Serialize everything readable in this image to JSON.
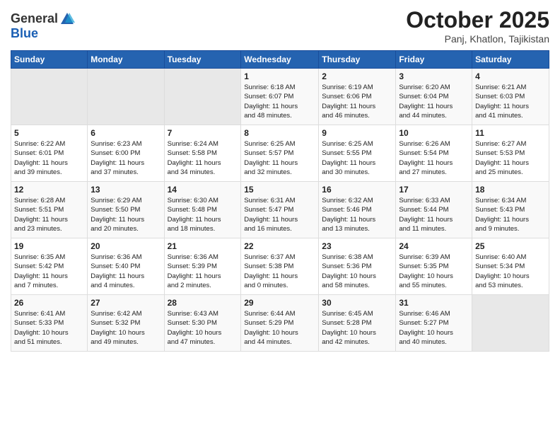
{
  "header": {
    "logo_general": "General",
    "logo_blue": "Blue",
    "month": "October 2025",
    "location": "Panj, Khatlon, Tajikistan"
  },
  "weekdays": [
    "Sunday",
    "Monday",
    "Tuesday",
    "Wednesday",
    "Thursday",
    "Friday",
    "Saturday"
  ],
  "weeks": [
    [
      {
        "day": "",
        "info": ""
      },
      {
        "day": "",
        "info": ""
      },
      {
        "day": "",
        "info": ""
      },
      {
        "day": "1",
        "info": "Sunrise: 6:18 AM\nSunset: 6:07 PM\nDaylight: 11 hours\nand 48 minutes."
      },
      {
        "day": "2",
        "info": "Sunrise: 6:19 AM\nSunset: 6:06 PM\nDaylight: 11 hours\nand 46 minutes."
      },
      {
        "day": "3",
        "info": "Sunrise: 6:20 AM\nSunset: 6:04 PM\nDaylight: 11 hours\nand 44 minutes."
      },
      {
        "day": "4",
        "info": "Sunrise: 6:21 AM\nSunset: 6:03 PM\nDaylight: 11 hours\nand 41 minutes."
      }
    ],
    [
      {
        "day": "5",
        "info": "Sunrise: 6:22 AM\nSunset: 6:01 PM\nDaylight: 11 hours\nand 39 minutes."
      },
      {
        "day": "6",
        "info": "Sunrise: 6:23 AM\nSunset: 6:00 PM\nDaylight: 11 hours\nand 37 minutes."
      },
      {
        "day": "7",
        "info": "Sunrise: 6:24 AM\nSunset: 5:58 PM\nDaylight: 11 hours\nand 34 minutes."
      },
      {
        "day": "8",
        "info": "Sunrise: 6:25 AM\nSunset: 5:57 PM\nDaylight: 11 hours\nand 32 minutes."
      },
      {
        "day": "9",
        "info": "Sunrise: 6:25 AM\nSunset: 5:55 PM\nDaylight: 11 hours\nand 30 minutes."
      },
      {
        "day": "10",
        "info": "Sunrise: 6:26 AM\nSunset: 5:54 PM\nDaylight: 11 hours\nand 27 minutes."
      },
      {
        "day": "11",
        "info": "Sunrise: 6:27 AM\nSunset: 5:53 PM\nDaylight: 11 hours\nand 25 minutes."
      }
    ],
    [
      {
        "day": "12",
        "info": "Sunrise: 6:28 AM\nSunset: 5:51 PM\nDaylight: 11 hours\nand 23 minutes."
      },
      {
        "day": "13",
        "info": "Sunrise: 6:29 AM\nSunset: 5:50 PM\nDaylight: 11 hours\nand 20 minutes."
      },
      {
        "day": "14",
        "info": "Sunrise: 6:30 AM\nSunset: 5:48 PM\nDaylight: 11 hours\nand 18 minutes."
      },
      {
        "day": "15",
        "info": "Sunrise: 6:31 AM\nSunset: 5:47 PM\nDaylight: 11 hours\nand 16 minutes."
      },
      {
        "day": "16",
        "info": "Sunrise: 6:32 AM\nSunset: 5:46 PM\nDaylight: 11 hours\nand 13 minutes."
      },
      {
        "day": "17",
        "info": "Sunrise: 6:33 AM\nSunset: 5:44 PM\nDaylight: 11 hours\nand 11 minutes."
      },
      {
        "day": "18",
        "info": "Sunrise: 6:34 AM\nSunset: 5:43 PM\nDaylight: 11 hours\nand 9 minutes."
      }
    ],
    [
      {
        "day": "19",
        "info": "Sunrise: 6:35 AM\nSunset: 5:42 PM\nDaylight: 11 hours\nand 7 minutes."
      },
      {
        "day": "20",
        "info": "Sunrise: 6:36 AM\nSunset: 5:40 PM\nDaylight: 11 hours\nand 4 minutes."
      },
      {
        "day": "21",
        "info": "Sunrise: 6:36 AM\nSunset: 5:39 PM\nDaylight: 11 hours\nand 2 minutes."
      },
      {
        "day": "22",
        "info": "Sunrise: 6:37 AM\nSunset: 5:38 PM\nDaylight: 11 hours\nand 0 minutes."
      },
      {
        "day": "23",
        "info": "Sunrise: 6:38 AM\nSunset: 5:36 PM\nDaylight: 10 hours\nand 58 minutes."
      },
      {
        "day": "24",
        "info": "Sunrise: 6:39 AM\nSunset: 5:35 PM\nDaylight: 10 hours\nand 55 minutes."
      },
      {
        "day": "25",
        "info": "Sunrise: 6:40 AM\nSunset: 5:34 PM\nDaylight: 10 hours\nand 53 minutes."
      }
    ],
    [
      {
        "day": "26",
        "info": "Sunrise: 6:41 AM\nSunset: 5:33 PM\nDaylight: 10 hours\nand 51 minutes."
      },
      {
        "day": "27",
        "info": "Sunrise: 6:42 AM\nSunset: 5:32 PM\nDaylight: 10 hours\nand 49 minutes."
      },
      {
        "day": "28",
        "info": "Sunrise: 6:43 AM\nSunset: 5:30 PM\nDaylight: 10 hours\nand 47 minutes."
      },
      {
        "day": "29",
        "info": "Sunrise: 6:44 AM\nSunset: 5:29 PM\nDaylight: 10 hours\nand 44 minutes."
      },
      {
        "day": "30",
        "info": "Sunrise: 6:45 AM\nSunset: 5:28 PM\nDaylight: 10 hours\nand 42 minutes."
      },
      {
        "day": "31",
        "info": "Sunrise: 6:46 AM\nSunset: 5:27 PM\nDaylight: 10 hours\nand 40 minutes."
      },
      {
        "day": "",
        "info": ""
      }
    ]
  ]
}
